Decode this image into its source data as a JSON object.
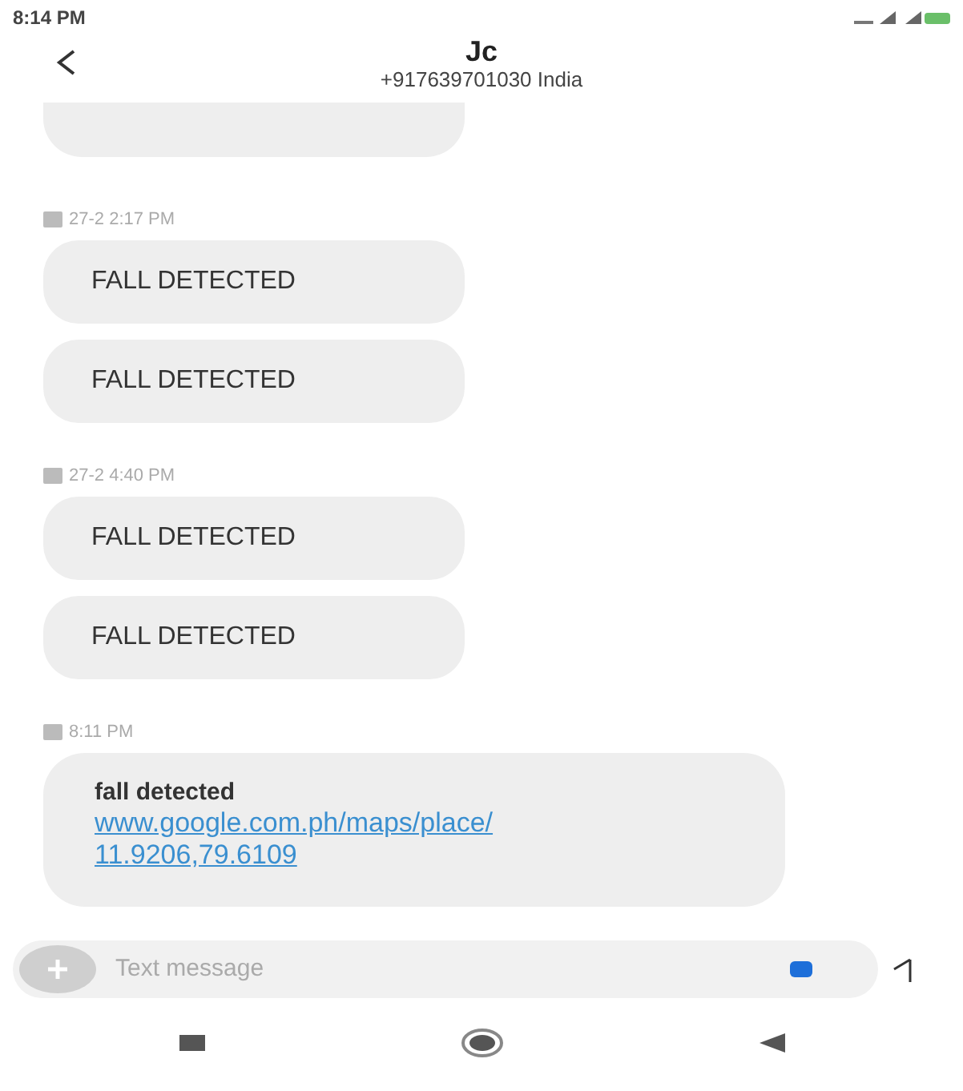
{
  "status_bar": {
    "time": "8:14 PM"
  },
  "header": {
    "name": "Jc",
    "number": "+917639701030 India"
  },
  "messages": [
    {
      "kind": "cut"
    },
    {
      "kind": "stamp",
      "text": "27-2 2:17 PM"
    },
    {
      "kind": "bubble",
      "text": "FALL DETECTED"
    },
    {
      "kind": "bubble",
      "text": "FALL DETECTED"
    },
    {
      "kind": "stamp",
      "text": "27-2 4:40 PM"
    },
    {
      "kind": "bubble",
      "text": "FALL DETECTED"
    },
    {
      "kind": "bubble",
      "text": "FALL DETECTED"
    },
    {
      "kind": "stamp",
      "text": "8:11 PM"
    },
    {
      "kind": "link",
      "text": "fall detected",
      "link": "www.google.com.ph/maps/place/ 11.9206,79.6109"
    }
  ],
  "composer": {
    "placeholder": "Text message"
  }
}
